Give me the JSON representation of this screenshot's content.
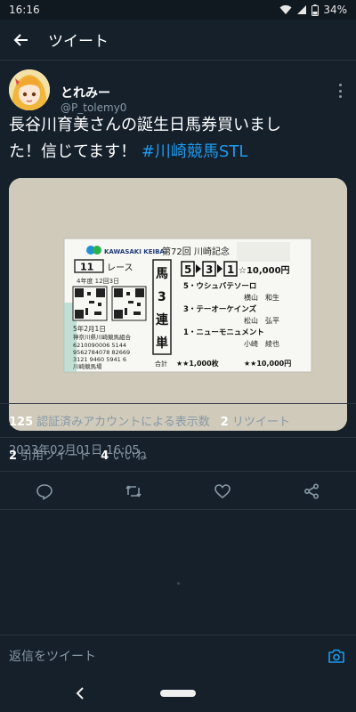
{
  "status": {
    "time": "16:16",
    "battery": "34%"
  },
  "header": {
    "title": "ツイート"
  },
  "tweet": {
    "author_name": "とれみー",
    "author_handle": "@P_tolemy0",
    "text_line1": "長谷川育美さんの誕生日馬券買いまし",
    "text_line2": "た！信じてます！",
    "hashtag": "#川崎競馬STL",
    "timestamp": "2023年02月01日 16:05"
  },
  "ticket": {
    "logo": "KAWASAKI KEIBA",
    "race_title": "第72回 川崎記念",
    "race_no": "11",
    "race_label": "レース",
    "date_info": "4年度 12回3日",
    "type_chars": [
      "馬",
      "3",
      "連",
      "単"
    ],
    "picks": [
      "5",
      "3",
      "1"
    ],
    "amount": "☆10,000円",
    "horses": [
      {
        "line": "5・ウシュバテソーロ",
        "jockey": "横山　和生"
      },
      {
        "line": "3・テーオーケインズ",
        "jockey": "松山　弘平"
      },
      {
        "line": "1・ニューモニュメント",
        "jockey": "小崎　綾也"
      }
    ],
    "issue_date": "5年2月1日",
    "issuer": "神奈川県川崎競馬組合",
    "serial1": "6210090006 5144",
    "serial2": "9562784078 82669",
    "serial3": "3121 9460 5941 6",
    "venue": "川崎競馬場",
    "total_label": "合計",
    "total_count": "★★1,000枚",
    "total_amount": "★★10,000円"
  },
  "stats": {
    "views_count": "125",
    "views_label": "認証済みアカウントによる表示数",
    "retweets_count": "2",
    "retweets_label": "リツイート",
    "quotes_count": "2",
    "quotes_label": "引用ツイート",
    "likes_count": "4",
    "likes_label": "いいね"
  },
  "reply": {
    "placeholder": "返信をツイート"
  },
  "icons": {
    "back": "arrow-left-icon",
    "more": "more-vertical-icon",
    "reply": "reply-icon",
    "retweet": "retweet-icon",
    "like": "heart-icon",
    "share": "share-icon",
    "camera": "camera-icon"
  },
  "colors": {
    "background": "#15202b",
    "accent": "#1d9bf0",
    "muted": "#8899a6"
  }
}
